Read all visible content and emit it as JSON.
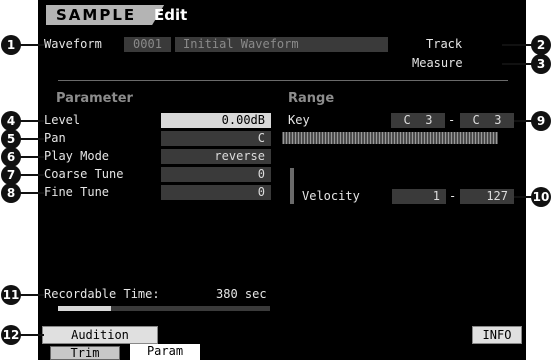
{
  "header": {
    "mode": "SAMPLE",
    "page": "Edit"
  },
  "waveform": {
    "label": "Waveform",
    "number": "0001",
    "name": "Initial Waveform"
  },
  "right_info": {
    "track": "Track",
    "measure": "Measure"
  },
  "parameter": {
    "heading": "Parameter",
    "rows": [
      {
        "label": "Level",
        "value": "0.00dB",
        "selected": true
      },
      {
        "label": "Pan",
        "value": "C"
      },
      {
        "label": "Play Mode",
        "value": "reverse"
      },
      {
        "label": "Coarse Tune",
        "value": "0"
      },
      {
        "label": "Fine Tune",
        "value": "0"
      }
    ]
  },
  "range": {
    "heading": "Range",
    "key_label": "Key",
    "key_low": "C  3",
    "key_high": "C  3",
    "dash": "-",
    "velocity_label": "Velocity",
    "velocity_low": "1",
    "velocity_high": "127"
  },
  "recordable": {
    "label": "Recordable Time:",
    "value": "380",
    "unit": "sec",
    "fill_fraction": 0.25
  },
  "buttons": {
    "audition": "Audition",
    "info": "INFO"
  },
  "tabs": [
    {
      "label": "Trim",
      "active": false
    },
    {
      "label": "Param",
      "active": true
    }
  ],
  "callouts": [
    "1",
    "2",
    "3",
    "4",
    "5",
    "6",
    "7",
    "8",
    "9",
    "10",
    "11",
    "12"
  ]
}
